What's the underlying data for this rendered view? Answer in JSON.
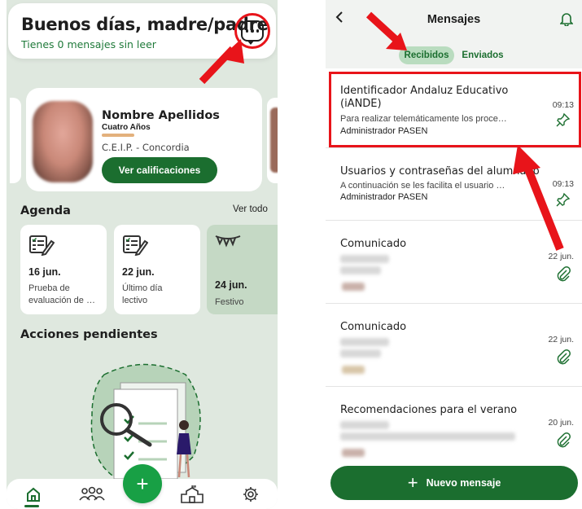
{
  "home": {
    "greeting": "Buenos días, madre/padre",
    "unread": "Tienes 0 mensajes sin leer",
    "student": {
      "name": "Nombre Apellidos",
      "age": "Cuatro Años",
      "school": "C.E.I.P. - Concordia",
      "grades_button": "Ver calificaciones"
    },
    "agenda": {
      "title": "Agenda",
      "see_all": "Ver todo",
      "items": [
        {
          "date": "16 jun.",
          "desc": "Prueba de\nevaluación de …",
          "icon": "exam-icon"
        },
        {
          "date": "22 jun.",
          "desc": "Último día\nlectivo",
          "icon": "exam-icon"
        },
        {
          "date": "24 jun.",
          "desc": "Festivo",
          "icon": "bunting-icon"
        }
      ]
    },
    "pending_title": "Acciones pendientes",
    "nav": [
      "home-icon",
      "people-icon",
      "add-icon",
      "school-icon",
      "settings-icon"
    ]
  },
  "messages": {
    "title": "Mensajes",
    "tabs": {
      "received": "Recibidos",
      "sent": "Enviados"
    },
    "list": [
      {
        "subject": "Identificador Andaluz Educativo\n(iANDE)",
        "preview": "Para realizar telemáticamente los proce…",
        "sender": "Administrador PASEN",
        "time": "09:13",
        "icon": "pin-icon"
      },
      {
        "subject": "Usuarios y contraseñas del alumnado",
        "preview": "A continuación se les facilita el usuario …",
        "sender": "Administrador PASEN",
        "time": "09:13",
        "icon": "pin-icon"
      },
      {
        "subject": "Comunicado",
        "preview": "",
        "sender": "",
        "time": "22 jun.",
        "icon": "paperclip-icon"
      },
      {
        "subject": "Comunicado",
        "preview": "",
        "sender": "",
        "time": "22 jun.",
        "icon": "paperclip-icon"
      },
      {
        "subject": "Recomendaciones para el verano",
        "preview": "",
        "sender": "",
        "time": "20 jun.",
        "icon": "paperclip-icon"
      }
    ],
    "new_message": "Nuevo mensaje"
  },
  "colors": {
    "brand": "#1b6e2f",
    "accent": "#18a045",
    "annotation": "#e8141a",
    "background": "#dfe8df"
  }
}
